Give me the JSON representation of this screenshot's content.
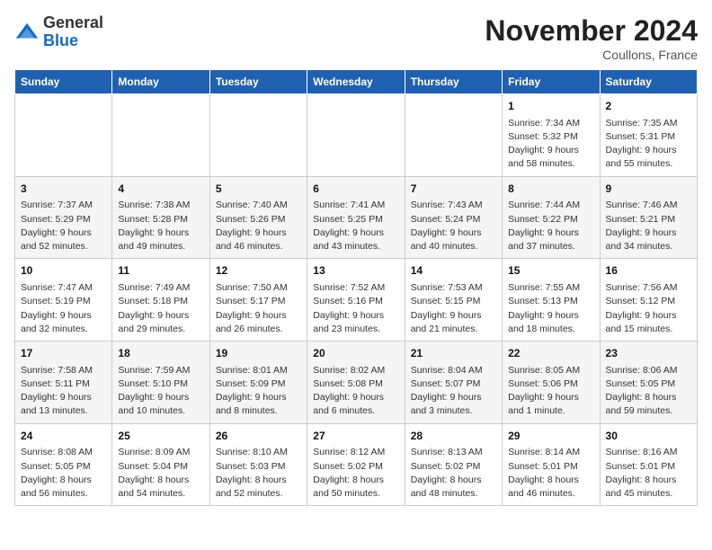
{
  "header": {
    "logo_line1": "General",
    "logo_line2": "Blue",
    "month": "November 2024",
    "location": "Coullons, France"
  },
  "days_of_week": [
    "Sunday",
    "Monday",
    "Tuesday",
    "Wednesday",
    "Thursday",
    "Friday",
    "Saturday"
  ],
  "weeks": [
    [
      {
        "day": "",
        "info": ""
      },
      {
        "day": "",
        "info": ""
      },
      {
        "day": "",
        "info": ""
      },
      {
        "day": "",
        "info": ""
      },
      {
        "day": "",
        "info": ""
      },
      {
        "day": "1",
        "info": "Sunrise: 7:34 AM\nSunset: 5:32 PM\nDaylight: 9 hours and 58 minutes."
      },
      {
        "day": "2",
        "info": "Sunrise: 7:35 AM\nSunset: 5:31 PM\nDaylight: 9 hours and 55 minutes."
      }
    ],
    [
      {
        "day": "3",
        "info": "Sunrise: 7:37 AM\nSunset: 5:29 PM\nDaylight: 9 hours and 52 minutes."
      },
      {
        "day": "4",
        "info": "Sunrise: 7:38 AM\nSunset: 5:28 PM\nDaylight: 9 hours and 49 minutes."
      },
      {
        "day": "5",
        "info": "Sunrise: 7:40 AM\nSunset: 5:26 PM\nDaylight: 9 hours and 46 minutes."
      },
      {
        "day": "6",
        "info": "Sunrise: 7:41 AM\nSunset: 5:25 PM\nDaylight: 9 hours and 43 minutes."
      },
      {
        "day": "7",
        "info": "Sunrise: 7:43 AM\nSunset: 5:24 PM\nDaylight: 9 hours and 40 minutes."
      },
      {
        "day": "8",
        "info": "Sunrise: 7:44 AM\nSunset: 5:22 PM\nDaylight: 9 hours and 37 minutes."
      },
      {
        "day": "9",
        "info": "Sunrise: 7:46 AM\nSunset: 5:21 PM\nDaylight: 9 hours and 34 minutes."
      }
    ],
    [
      {
        "day": "10",
        "info": "Sunrise: 7:47 AM\nSunset: 5:19 PM\nDaylight: 9 hours and 32 minutes."
      },
      {
        "day": "11",
        "info": "Sunrise: 7:49 AM\nSunset: 5:18 PM\nDaylight: 9 hours and 29 minutes."
      },
      {
        "day": "12",
        "info": "Sunrise: 7:50 AM\nSunset: 5:17 PM\nDaylight: 9 hours and 26 minutes."
      },
      {
        "day": "13",
        "info": "Sunrise: 7:52 AM\nSunset: 5:16 PM\nDaylight: 9 hours and 23 minutes."
      },
      {
        "day": "14",
        "info": "Sunrise: 7:53 AM\nSunset: 5:15 PM\nDaylight: 9 hours and 21 minutes."
      },
      {
        "day": "15",
        "info": "Sunrise: 7:55 AM\nSunset: 5:13 PM\nDaylight: 9 hours and 18 minutes."
      },
      {
        "day": "16",
        "info": "Sunrise: 7:56 AM\nSunset: 5:12 PM\nDaylight: 9 hours and 15 minutes."
      }
    ],
    [
      {
        "day": "17",
        "info": "Sunrise: 7:58 AM\nSunset: 5:11 PM\nDaylight: 9 hours and 13 minutes."
      },
      {
        "day": "18",
        "info": "Sunrise: 7:59 AM\nSunset: 5:10 PM\nDaylight: 9 hours and 10 minutes."
      },
      {
        "day": "19",
        "info": "Sunrise: 8:01 AM\nSunset: 5:09 PM\nDaylight: 9 hours and 8 minutes."
      },
      {
        "day": "20",
        "info": "Sunrise: 8:02 AM\nSunset: 5:08 PM\nDaylight: 9 hours and 6 minutes."
      },
      {
        "day": "21",
        "info": "Sunrise: 8:04 AM\nSunset: 5:07 PM\nDaylight: 9 hours and 3 minutes."
      },
      {
        "day": "22",
        "info": "Sunrise: 8:05 AM\nSunset: 5:06 PM\nDaylight: 9 hours and 1 minute."
      },
      {
        "day": "23",
        "info": "Sunrise: 8:06 AM\nSunset: 5:05 PM\nDaylight: 8 hours and 59 minutes."
      }
    ],
    [
      {
        "day": "24",
        "info": "Sunrise: 8:08 AM\nSunset: 5:05 PM\nDaylight: 8 hours and 56 minutes."
      },
      {
        "day": "25",
        "info": "Sunrise: 8:09 AM\nSunset: 5:04 PM\nDaylight: 8 hours and 54 minutes."
      },
      {
        "day": "26",
        "info": "Sunrise: 8:10 AM\nSunset: 5:03 PM\nDaylight: 8 hours and 52 minutes."
      },
      {
        "day": "27",
        "info": "Sunrise: 8:12 AM\nSunset: 5:02 PM\nDaylight: 8 hours and 50 minutes."
      },
      {
        "day": "28",
        "info": "Sunrise: 8:13 AM\nSunset: 5:02 PM\nDaylight: 8 hours and 48 minutes."
      },
      {
        "day": "29",
        "info": "Sunrise: 8:14 AM\nSunset: 5:01 PM\nDaylight: 8 hours and 46 minutes."
      },
      {
        "day": "30",
        "info": "Sunrise: 8:16 AM\nSunset: 5:01 PM\nDaylight: 8 hours and 45 minutes."
      }
    ]
  ]
}
